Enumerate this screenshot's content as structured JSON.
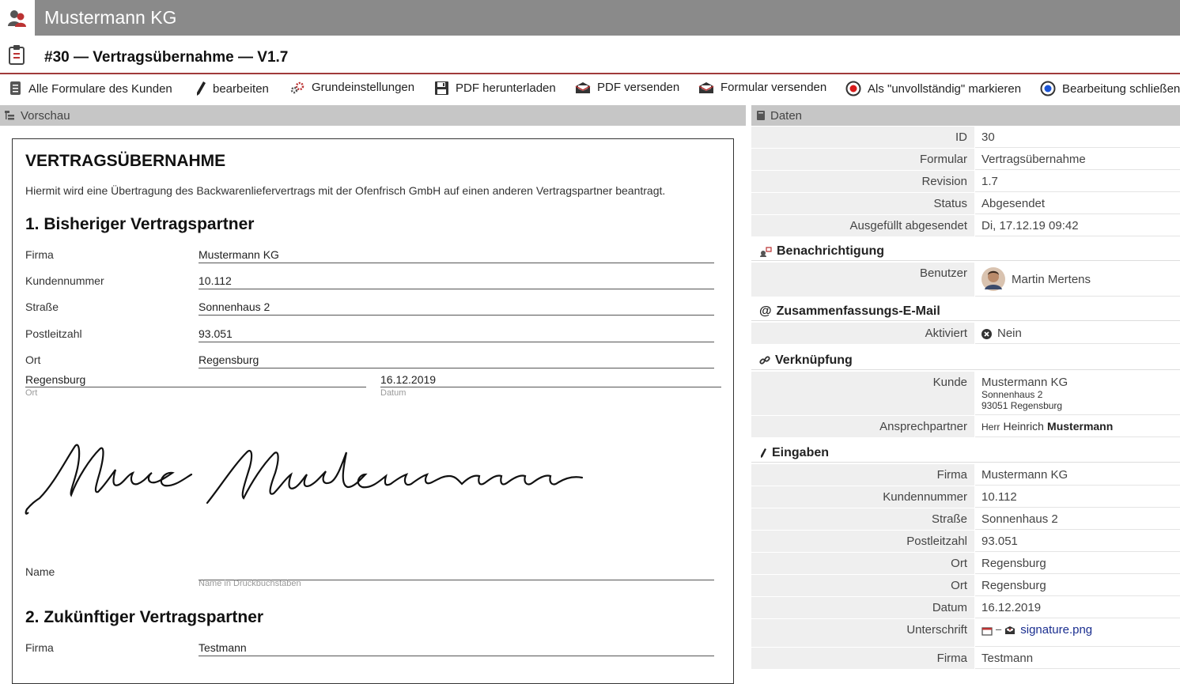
{
  "header": {
    "company": "Mustermann KG"
  },
  "page": {
    "title": "#30 — Vertragsübernahme — V1.7"
  },
  "toolbar": {
    "all_forms": "Alle Formulare des Kunden",
    "edit": "bearbeiten",
    "settings": "Grundeinstellungen",
    "download_pdf": "PDF herunterladen",
    "send_pdf": "PDF versenden",
    "send_form": "Formular versenden",
    "mark_incomplete": "Als \"unvollständig\" markieren",
    "close_edit": "Bearbeitung schließen"
  },
  "preview": {
    "header": "Vorschau",
    "heading": "VERTRAGSÜBERNAHME",
    "intro": "Hiermit wird eine Übertragung des Backwarenliefervertrags mit der Ofenfrisch GmbH auf einen anderen Vertragspartner beantragt.",
    "section1": "1. Bisheriger Vertragspartner",
    "fields1": [
      {
        "label": "Firma",
        "value": "Mustermann KG"
      },
      {
        "label": "Kundennummer",
        "value": "10.112"
      },
      {
        "label": "Straße",
        "value": "Sonnenhaus 2"
      },
      {
        "label": "Postleitzahl",
        "value": "93.051"
      },
      {
        "label": "Ort",
        "value": "Regensburg"
      }
    ],
    "place_value": "Regensburg",
    "place_label": "Ort",
    "date_value": "16.12.2019",
    "date_label": "Datum",
    "name_label": "Name",
    "name_sublabel": "Name in Druckbuchstaben",
    "section2": "2. Zukünftiger Vertragspartner",
    "fields2": [
      {
        "label": "Firma",
        "value": "Testmann"
      }
    ]
  },
  "data": {
    "header": "Daten",
    "meta": [
      {
        "key": "ID",
        "value": "30"
      },
      {
        "key": "Formular",
        "value": "Vertragsübernahme"
      },
      {
        "key": "Revision",
        "value": "1.7"
      },
      {
        "key": "Status",
        "value": "Abgesendet"
      },
      {
        "key": "Ausgefüllt abgesendet",
        "value": "Di, 17.12.19 09:42"
      }
    ],
    "notify_header": "Benachrichtigung",
    "notify_user_key": "Benutzer",
    "notify_user_name": "Martin Mertens",
    "email_header": "Zusammenfassungs-E-Mail",
    "email_key": "Aktiviert",
    "email_value": "Nein",
    "link_header": "Verknüpfung",
    "customer_key": "Kunde",
    "customer_name": "Mustermann KG",
    "customer_street": "Sonnenhaus 2",
    "customer_city": "93051 Regensburg",
    "contact_key": "Ansprechpartner",
    "contact_salutation": "Herr",
    "contact_first": "Heinrich",
    "contact_last": "Mustermann",
    "inputs_header": "Eingaben",
    "inputs": [
      {
        "key": "Firma",
        "value": "Mustermann KG"
      },
      {
        "key": "Kundennummer",
        "value": "10.112"
      },
      {
        "key": "Straße",
        "value": "Sonnenhaus 2"
      },
      {
        "key": "Postleitzahl",
        "value": "93.051"
      },
      {
        "key": "Ort",
        "value": "Regensburg"
      },
      {
        "key": "Ort",
        "value": "Regensburg"
      },
      {
        "key": "Datum",
        "value": "16.12.2019"
      }
    ],
    "signature_key": "Unterschrift",
    "signature_sep": "–",
    "signature_file": "signature.png",
    "last_key": "Firma",
    "last_value": "Testmann"
  },
  "colors": {
    "brand_red": "#a03b3b",
    "header_gray": "#8a8a8a",
    "link_blue": "#1a2e8f"
  }
}
